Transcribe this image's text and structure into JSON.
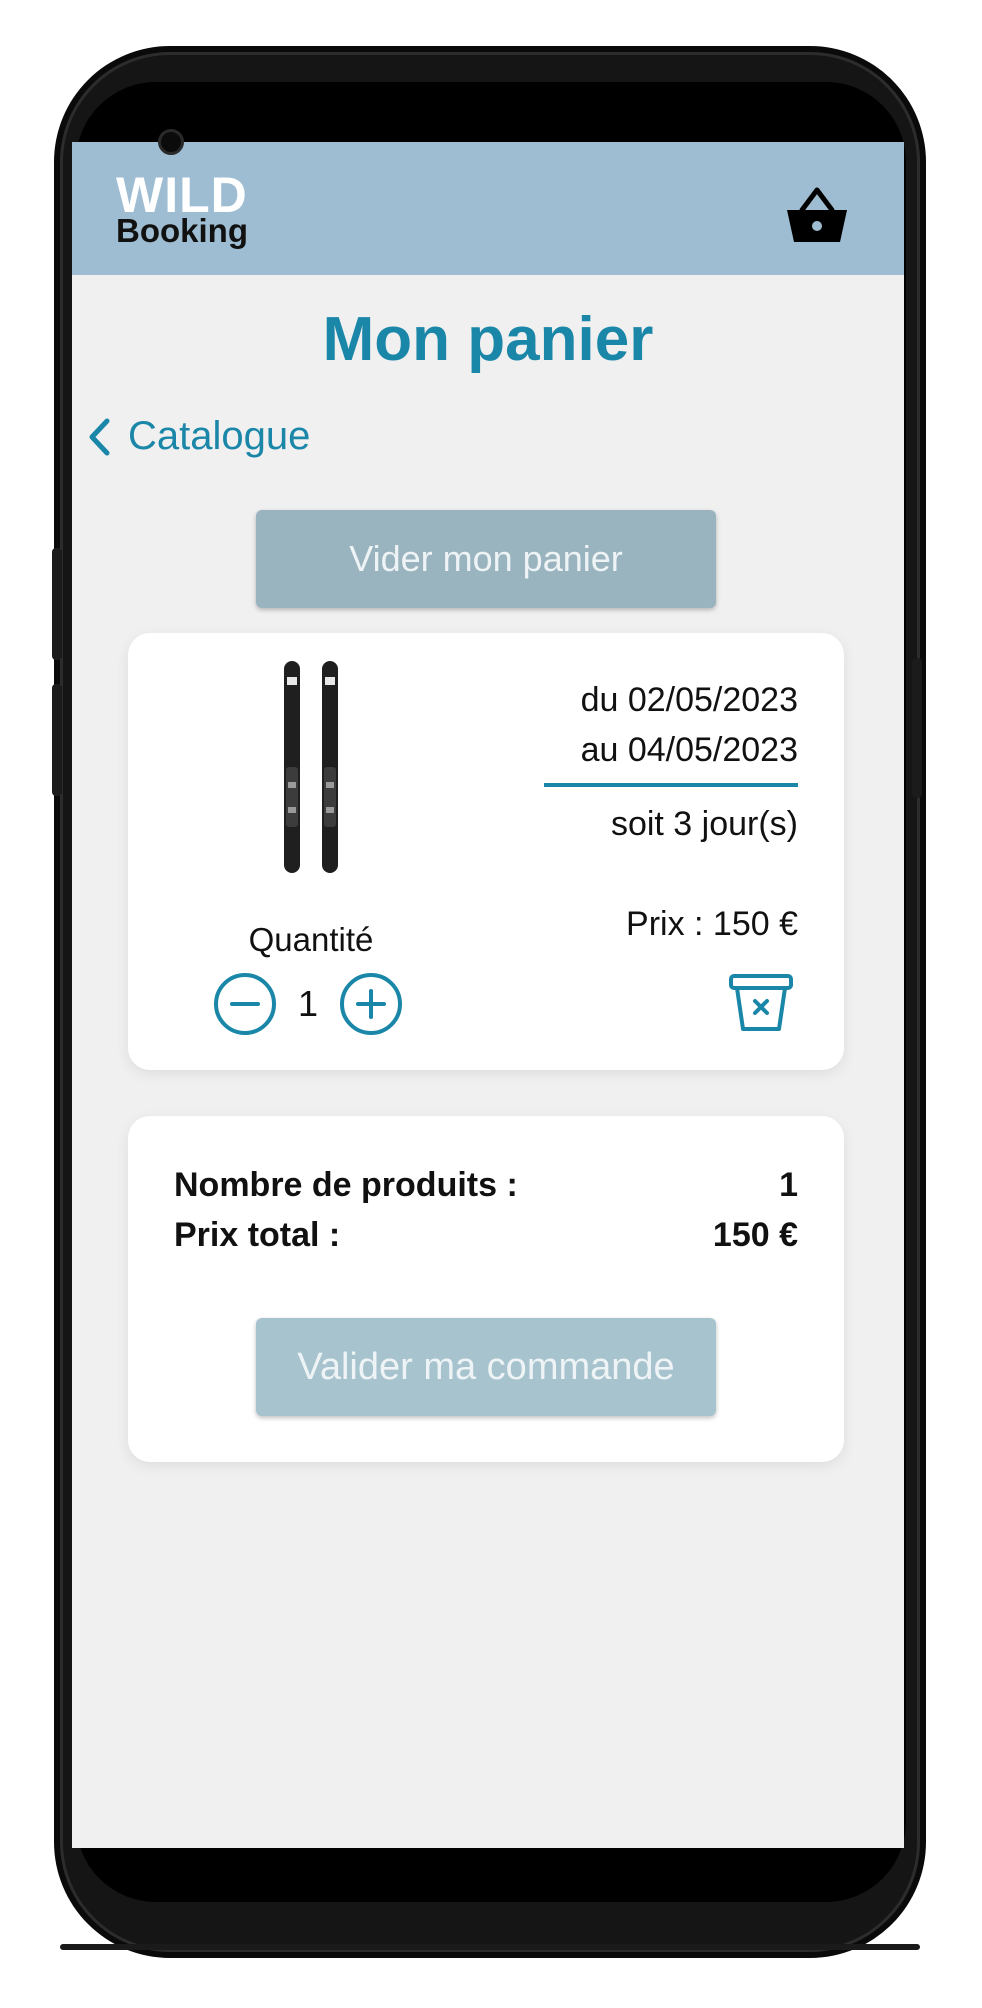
{
  "header": {
    "logo_line1": "WILD",
    "logo_line2": "Booking",
    "cart_icon": "basket-icon"
  },
  "page": {
    "title": "Mon panier",
    "back_label": "Catalogue",
    "empty_cart_label": "Vider mon panier"
  },
  "cart_item": {
    "image": "skis",
    "quantity_label": "Quantité",
    "quantity": "1",
    "date_from": "du 02/05/2023",
    "date_to": "au 04/05/2023",
    "duration": "soit 3 jour(s)",
    "price": "Prix : 150 €",
    "delete_icon": "trash-icon"
  },
  "summary": {
    "products_label": "Nombre de produits :",
    "products_value": "1",
    "total_label": "Prix total :",
    "total_value": "150 €",
    "validate_label": "Valider ma commande"
  },
  "colors": {
    "accent": "#1a86a8",
    "header_bg": "#9ebdd2",
    "button_bg": "#9ab4bf",
    "screen_bg": "#f0f0f0"
  }
}
